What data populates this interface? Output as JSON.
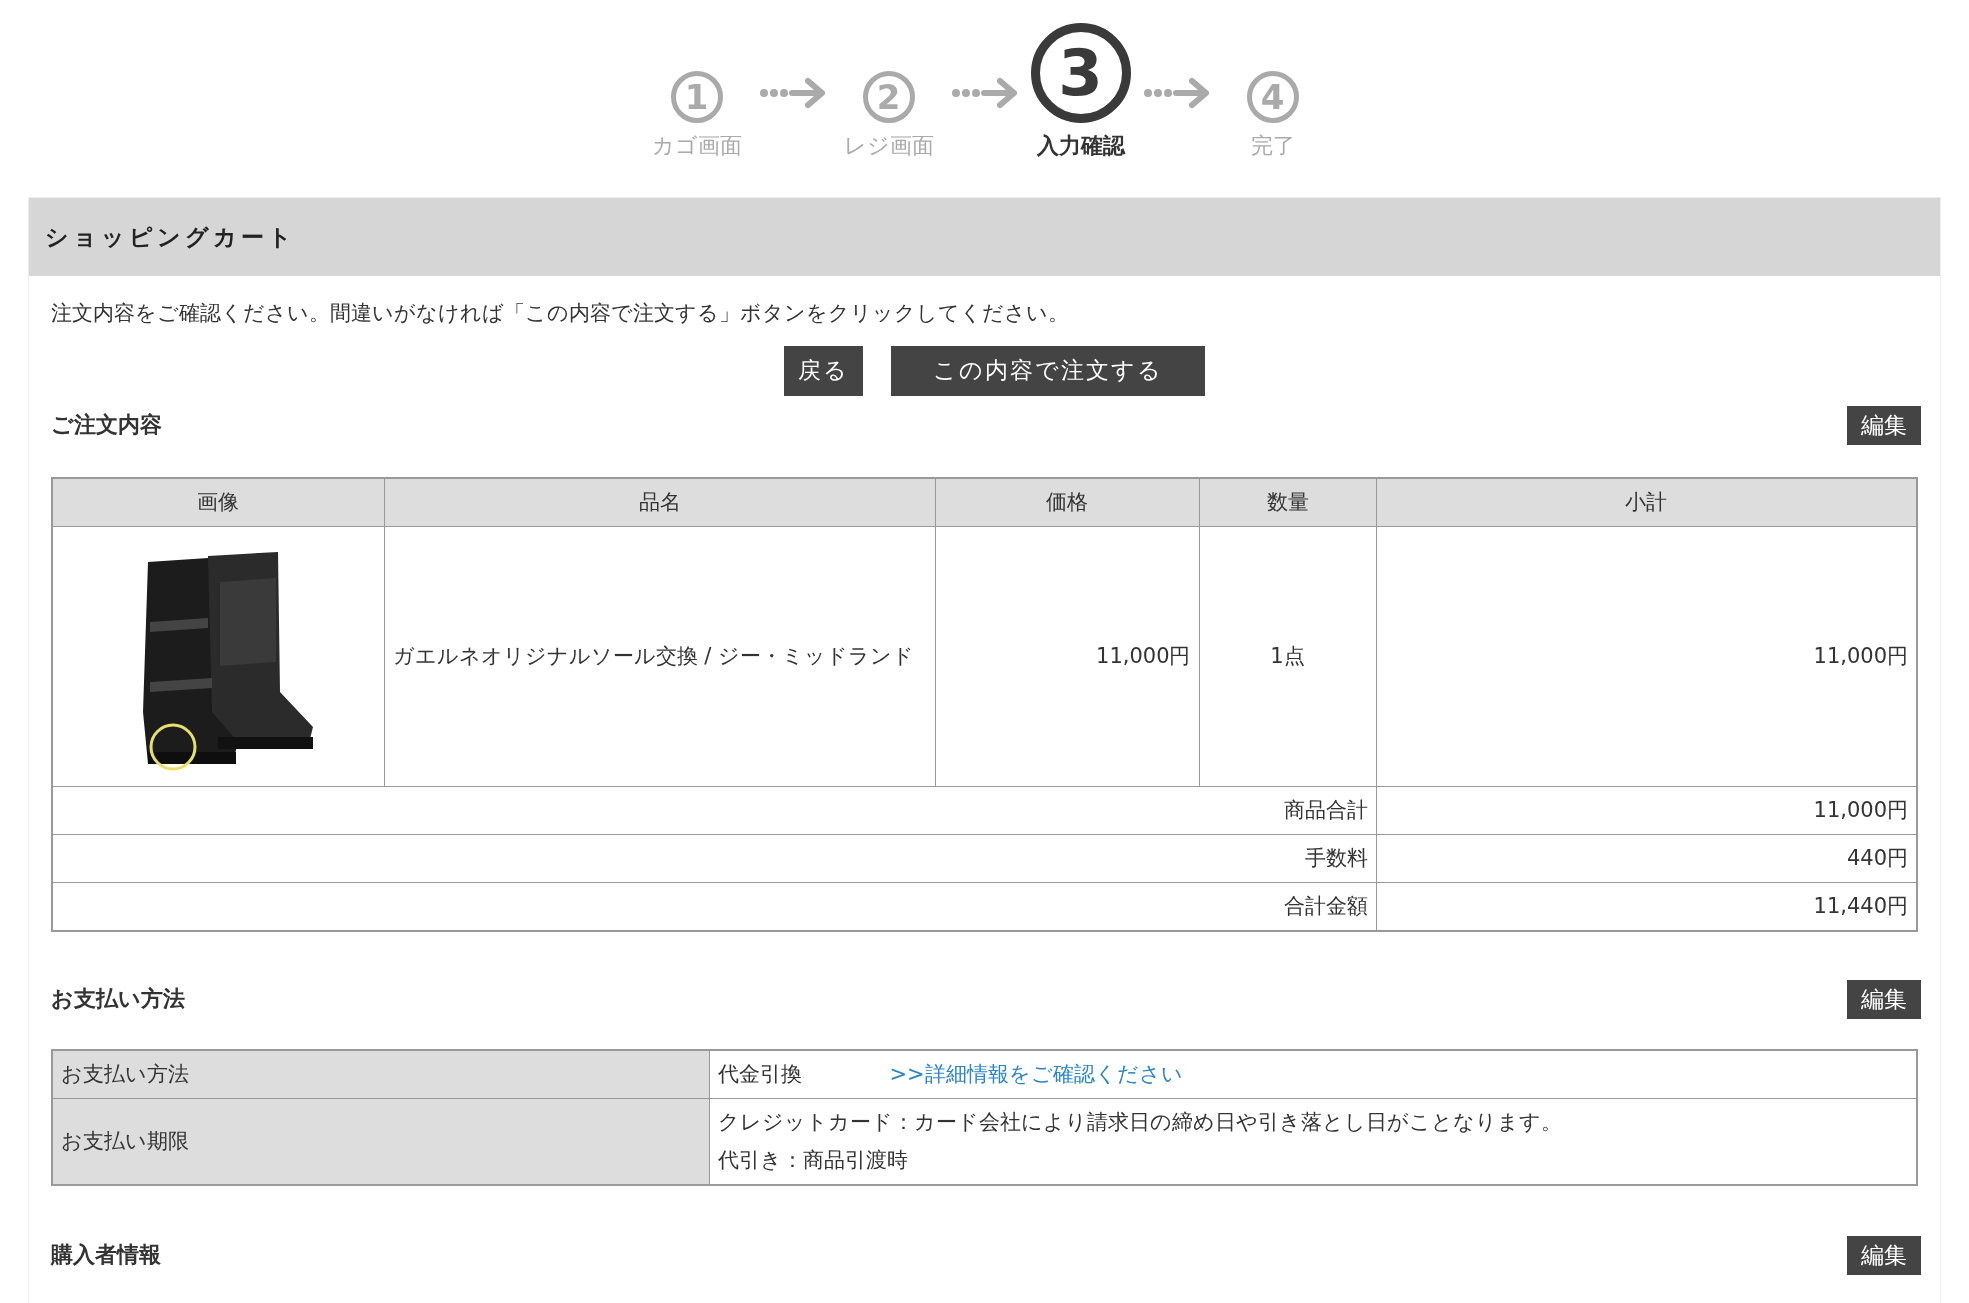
{
  "steps": [
    {
      "number": "1",
      "label": "カゴ画面",
      "selected": false
    },
    {
      "number": "2",
      "label": "レジ画面",
      "selected": false
    },
    {
      "number": "3",
      "label": "入力確認",
      "selected": true
    },
    {
      "number": "4",
      "label": "完了",
      "selected": false
    }
  ],
  "header": {
    "title": "ショッピングカート"
  },
  "intro": "注文内容をご確認ください。間違いがなければ「この内容で注文する」ボタンをクリックしてください。",
  "buttons": [
    {
      "label": "戻る",
      "kind": "back"
    },
    {
      "label": "この内容で注文する",
      "kind": "submit"
    }
  ],
  "order": {
    "title": "ご注文内容",
    "edit": "編集",
    "columns": [
      "画像",
      "品名",
      "価格",
      "数量",
      "小計"
    ],
    "items": [
      {
        "name": "ガエルネオリジナルソール交換 / ジー・ミッドランド",
        "price": "11,000円",
        "quantity": "1点",
        "subtotal": "11,000円"
      }
    ],
    "totals": [
      {
        "label": "商品合計",
        "value": "11,000円"
      },
      {
        "label": "手数料",
        "value": "440円"
      },
      {
        "label": "合計金額",
        "value": "11,440円"
      }
    ]
  },
  "payment": {
    "title": "お支払い方法",
    "edit": "編集",
    "rows": [
      {
        "label": "お支払い方法",
        "lines": [
          "代金引換"
        ],
        "link": ">>詳細情報をご確認ください"
      },
      {
        "label": "お支払い期限",
        "lines": [
          "クレジットカード：カード会社により請求日の締め日や引き落とし日がことなります。",
          "代引き：商品引渡時"
        ]
      }
    ]
  },
  "buyer": {
    "title": "購入者情報",
    "edit": "編集"
  }
}
